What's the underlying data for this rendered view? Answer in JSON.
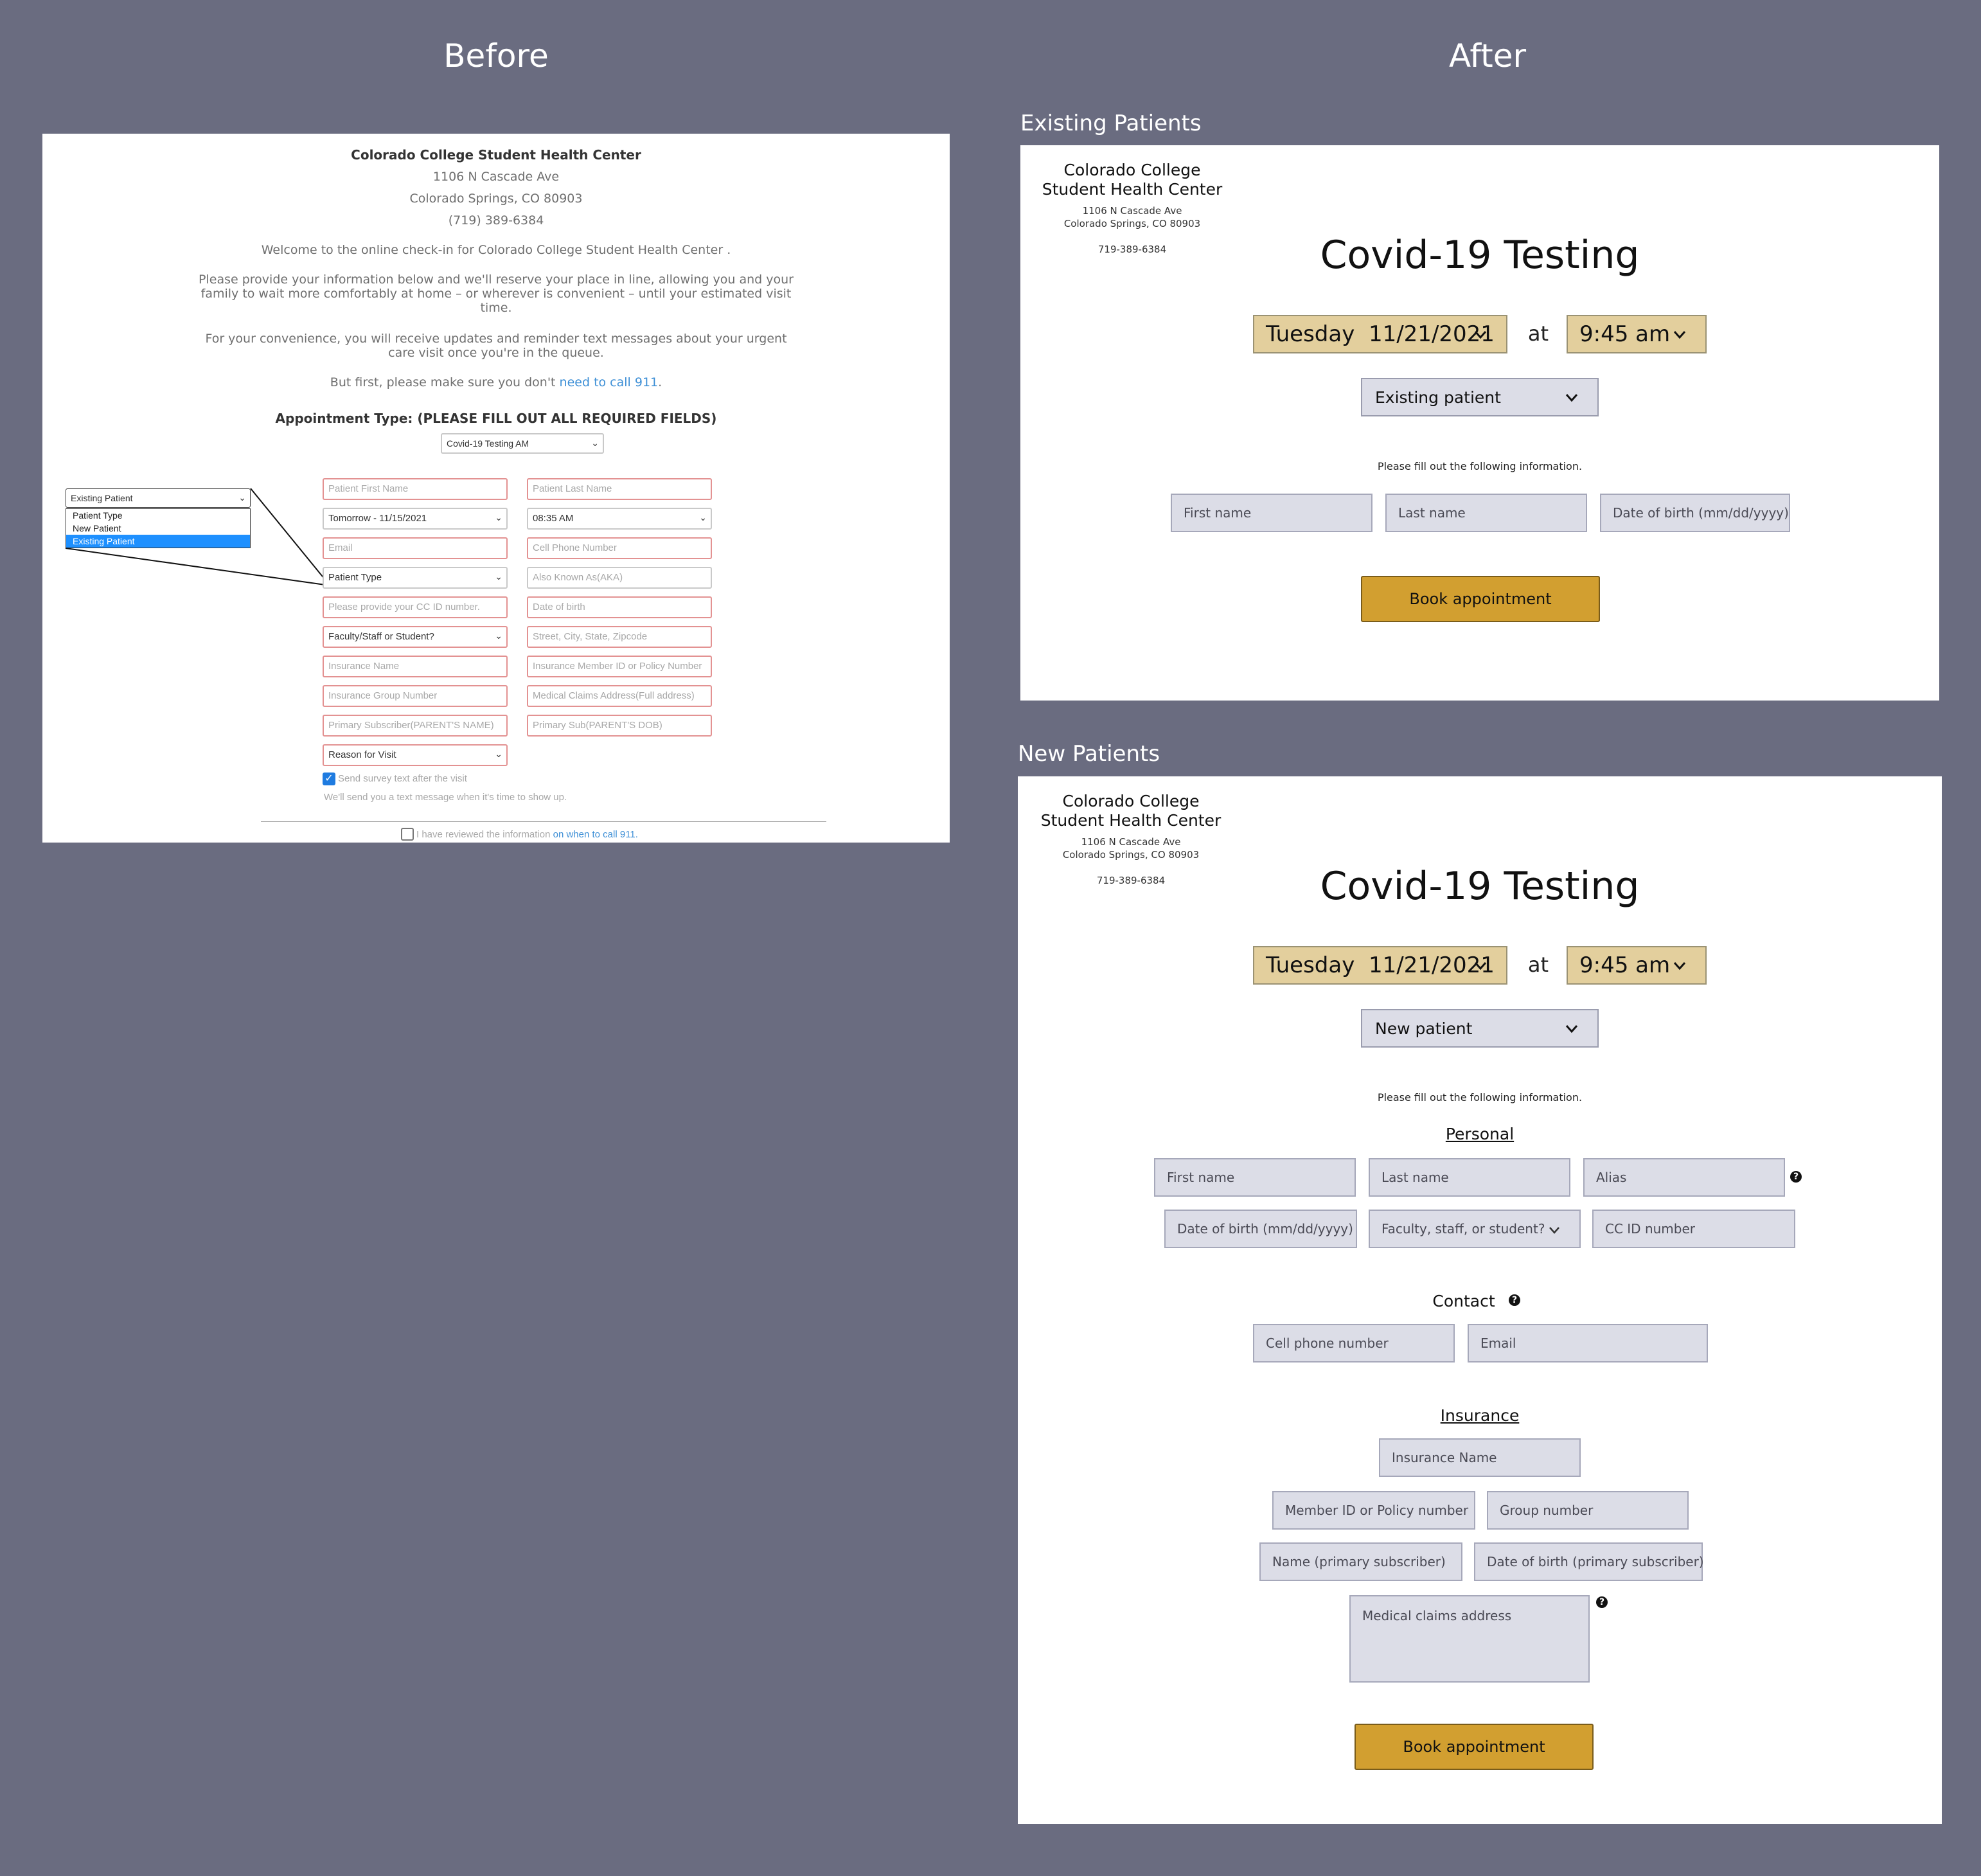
{
  "headings": {
    "before": "Before",
    "after": "After"
  },
  "sections": {
    "existing": "Existing Patients",
    "new": "New Patients"
  },
  "before": {
    "org": "Colorado College Student Health Center",
    "addr1": "1106 N Cascade Ave",
    "addr2": "Colorado Springs, CO 80903",
    "phone": "(719) 389-6384",
    "welcome": "Welcome to the online check-in for Colorado College Student Health Center .",
    "para1a": "Please provide your information below and we'll reserve your place in line, allowing you and your",
    "para1b": "family to wait more comfortably at home – or wherever is convenient – until your estimated visit",
    "para1c": "time.",
    "para2a": "For your convenience, you will receive updates and reminder text messages about your urgent",
    "para2b": "care visit once you're in the queue.",
    "but_first": "But first, please make sure you don't",
    "call_link": "need to call 911",
    "period": ".",
    "appt_type_label": "Appointment Type: (PLEASE FILL OUT ALL REQUIRED FIELDS)",
    "appt_type_value": "Covid-19 Testing AM",
    "dropdown": {
      "selected": "Existing Patient",
      "options": [
        "Patient Type",
        "New Patient",
        "Existing Patient"
      ]
    },
    "fields": {
      "first_name": "Patient First Name",
      "last_name": "Patient Last Name",
      "date": "Tomorrow - 11/15/2021",
      "time": "08:35 AM",
      "email": "Email",
      "cell": "Cell Phone Number",
      "patient_type": "Patient Type",
      "aka": "Also Known As(AKA)",
      "cc_id": "Please provide your CC ID number.",
      "dob": "Date of birth",
      "faculty": "Faculty/Staff or Student?",
      "address": "Street, City, State, Zipcode",
      "insurance_name": "Insurance Name",
      "member_id": "Insurance Member ID or Policy Number",
      "group_number": "Insurance Group Number",
      "claims_address": "Medical Claims Address(Full address)",
      "primary_sub": "Primary Subscriber(PARENT'S NAME)",
      "primary_sub_dob": "Primary Sub(PARENT'S DOB)",
      "reason": "Reason for Visit"
    },
    "survey_label": "Send survey text after the visit",
    "survey_checked": true,
    "text_note": "We'll send you a text message when it's time to show up.",
    "reviewed_label": "I have reviewed the information",
    "reviewed_link": "on when to call 911."
  },
  "after": {
    "org_line1": "Colorado College",
    "org_line2": "Student Health Center",
    "addr1": "1106 N Cascade Ave",
    "addr2": "Colorado Springs, CO 80903",
    "phone": "719-389-6384",
    "title": "Covid-19 Testing",
    "date": "Tuesday  11/21/2021",
    "at": "at",
    "time": "9:45 am",
    "instructions": "Please fill out the following information.",
    "book": "Book appointment",
    "existing": {
      "patient_type": "Existing patient",
      "first_name": "First name",
      "last_name": "Last name",
      "dob": "Date of birth (mm/dd/yyyy)"
    },
    "new": {
      "patient_type": "New patient",
      "personal": "Personal",
      "first_name": "First name",
      "last_name": "Last name",
      "alias": "Alias",
      "dob": "Date of birth (mm/dd/yyyy)",
      "faculty": "Faculty, staff, or student?",
      "cc_id": "CC ID number",
      "contact": "Contact",
      "cell": "Cell phone number",
      "email": "Email",
      "insurance": "Insurance",
      "insurance_name": "Insurance Name",
      "member_id": "Member ID or Policy number",
      "group_number": "Group number",
      "primary_name": "Name (primary subscriber)",
      "primary_dob": "Date of birth (primary subscriber)",
      "claims": "Medical claims address"
    },
    "help_glyph": "?"
  },
  "colors": {
    "background": "#6a6c80",
    "gold_button": "#d29f30",
    "gold_select": "#e3cf9d",
    "field": "#dcdde7",
    "link": "#3d8fd6",
    "error_border": "#e39292"
  }
}
